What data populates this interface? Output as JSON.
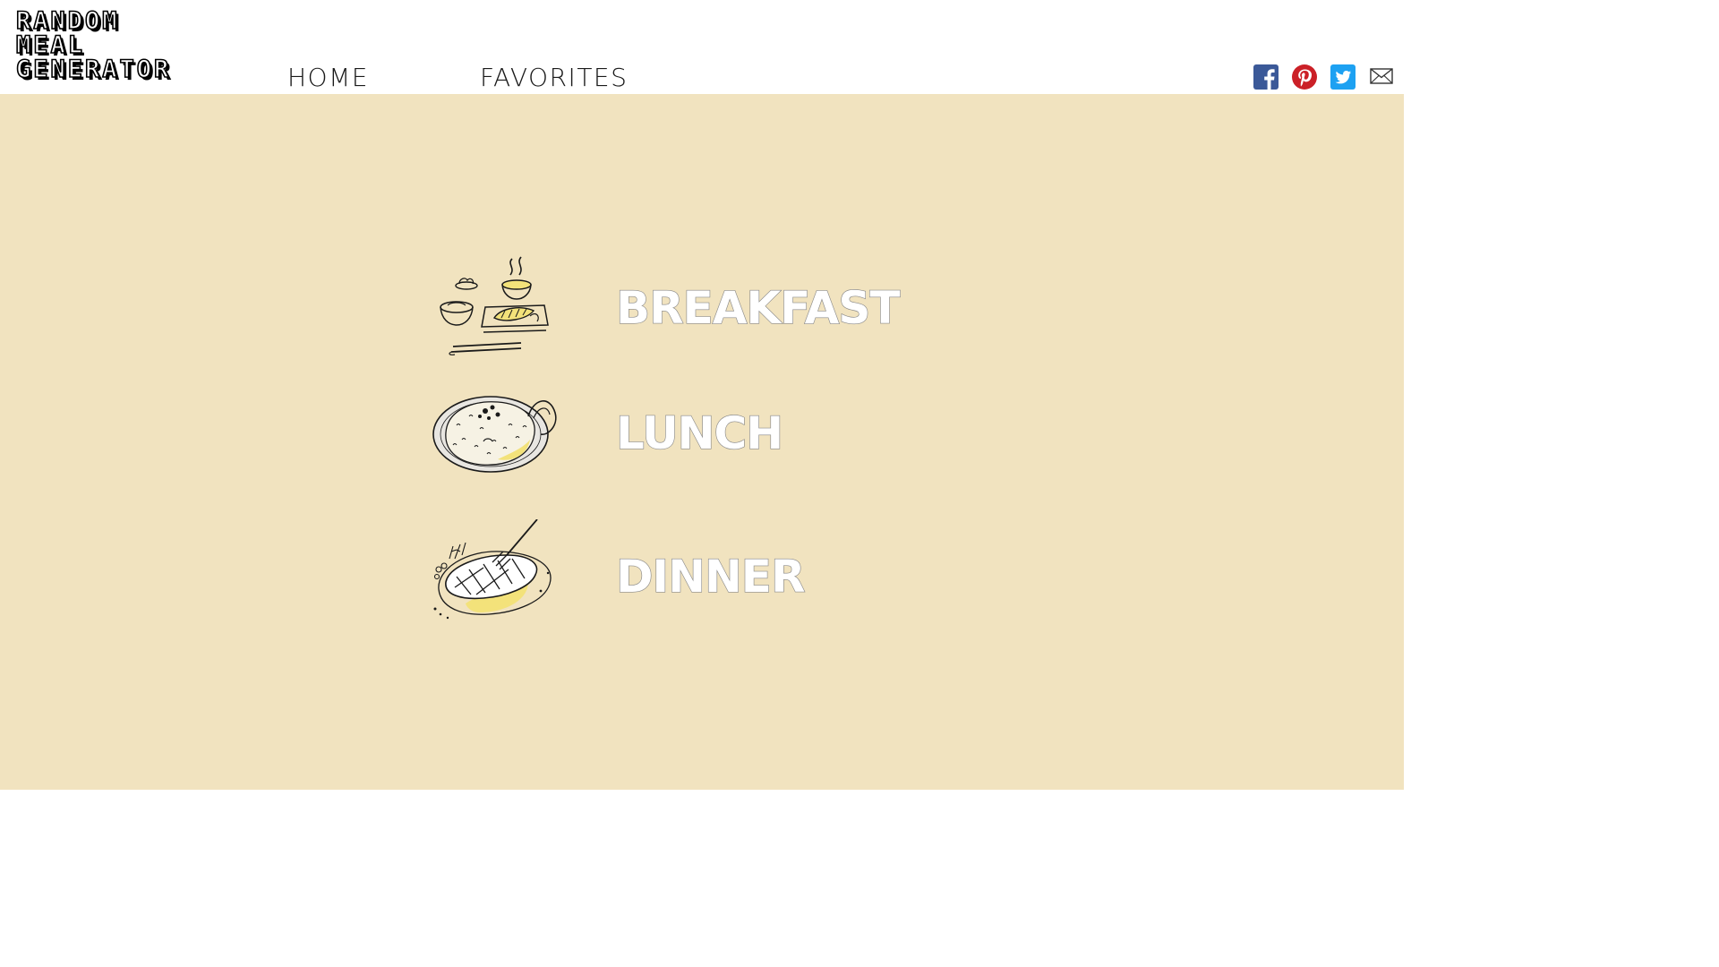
{
  "logo": {
    "line1": "RANDOM",
    "line2": "MEAL",
    "line3": "GENERATOR"
  },
  "nav": {
    "home": "HOME",
    "favorites": "FAVORITES"
  },
  "social": {
    "icons": [
      "facebook-icon",
      "pinterest-icon",
      "twitter-icon",
      "mail-icon"
    ],
    "colors": {
      "facebook": "#3b5998",
      "pinterest": "#cb2027",
      "twitter": "#1da1f2",
      "mail": "#333333"
    }
  },
  "meals": {
    "breakfast": {
      "label": "BREAKFAST",
      "icon": "breakfast-tray-icon"
    },
    "lunch": {
      "label": "LUNCH",
      "icon": "fried-rice-plate-icon"
    },
    "dinner": {
      "label": "DINNER",
      "icon": "steak-plate-icon"
    }
  },
  "colors": {
    "background": "#f1e3bf",
    "header": "#ffffff",
    "accent_yellow": "#f3e27a"
  }
}
